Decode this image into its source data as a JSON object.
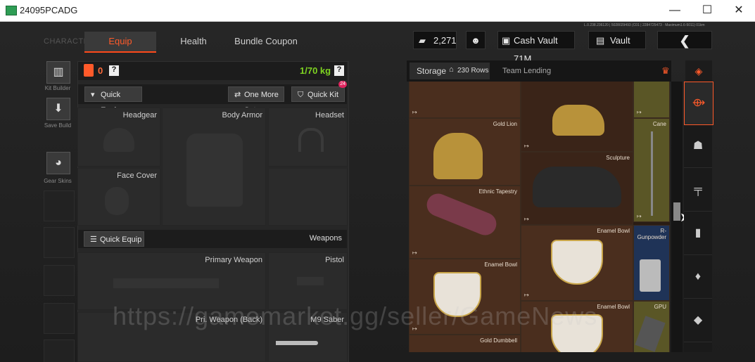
{
  "window": {
    "title": "24095PCADG",
    "minimize": "—",
    "maximize": "☐",
    "close": "✕"
  },
  "tabs": {
    "character": "CHARACTER",
    "items": [
      "Equip",
      "Health",
      "Bundle Coupon"
    ]
  },
  "top": {
    "currency": "2,271",
    "cash_vault": "Cash Vault 71M",
    "vault": "Vault",
    "version_line1": "L.0.238.236120 | 5028029493 (C01 | 2284725473 · Maximum1.6-5011) 01km"
  },
  "sidebar": [
    {
      "label": "Kit Builder"
    },
    {
      "label": "Save Build"
    },
    {
      "label": "Gear Skins"
    }
  ],
  "equip": {
    "armor_count": "0",
    "help": "?",
    "weight": "1/70 kg",
    "quick_equip": "Quick Equip",
    "one_more_set": "One More Set",
    "quick_kit": "Quick Kit",
    "quick_kit_badge": "24",
    "slots": {
      "headgear": "Headgear",
      "body_armor": "Body Armor",
      "headset": "Headset",
      "face_cover": "Face Cover"
    },
    "weapons_header": "Weapons",
    "quick_equip_weapons": "Quick Equip",
    "weapon_slots": {
      "primary": "Primary Weapon",
      "pistol": "Pistol",
      "primary_back": "Pri. Weapon (Back)",
      "melee": "M9 Saber"
    }
  },
  "storage": {
    "tab": "Storage",
    "rows": "230 Rows",
    "team": "Team Lending"
  },
  "inventory": [
    {
      "label": "Gold Lion",
      "col": 0
    },
    {
      "label": "Gold Lion",
      "col": 0
    },
    {
      "label": "Cane",
      "col": 2
    },
    {
      "label": "Sculpture",
      "col": 1
    },
    {
      "label": "Ethnic Tapestry",
      "col": 0
    },
    {
      "label": "Enamel Bowl",
      "col": 1
    },
    {
      "label": "R-Gunpowder",
      "col": 2
    },
    {
      "label": "Enamel Bowl",
      "col": 0
    },
    {
      "label": "Enamel Bowl",
      "col": 1
    },
    {
      "label": "GPU",
      "col": 2
    },
    {
      "label": "Gold Dumbbell",
      "col": 0
    }
  ],
  "watermark": "https://gamemarket.gg/seller/GameNews",
  "colors": {
    "accent": "#ff5a2a",
    "weight": "#7ed321",
    "inventory_bg": "#4a2e1e"
  }
}
